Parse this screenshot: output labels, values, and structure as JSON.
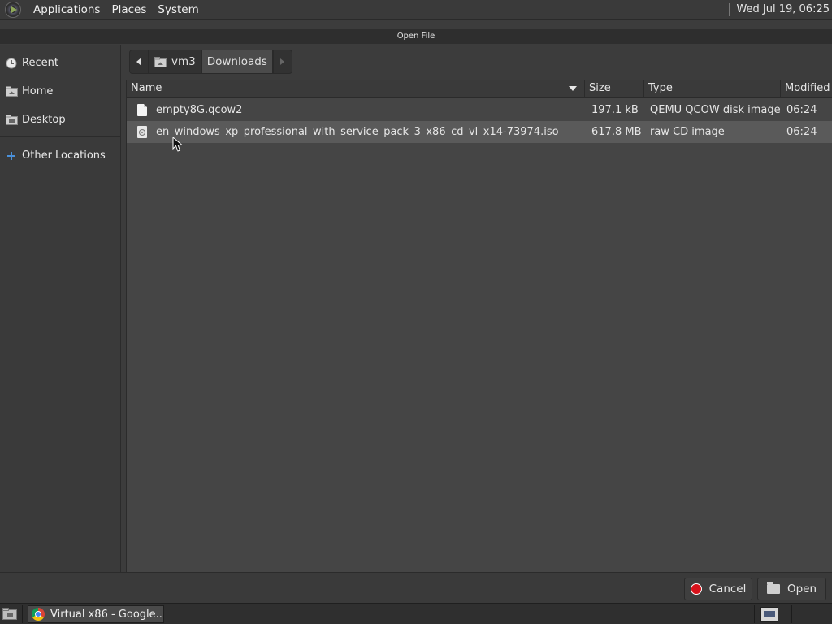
{
  "top_panel": {
    "menus": [
      "Applications",
      "Places",
      "System"
    ],
    "clock": "Wed Jul 19, 06:25"
  },
  "window": {
    "title": "Open File"
  },
  "sidebar": {
    "items": [
      {
        "label": "Recent",
        "icon": "recent-icon"
      },
      {
        "label": "Home",
        "icon": "home-icon"
      },
      {
        "label": "Desktop",
        "icon": "desktop-icon"
      },
      {
        "label": "Other Locations",
        "icon": "plus-icon"
      }
    ]
  },
  "pathbar": {
    "segments": [
      "vm3",
      "Downloads"
    ]
  },
  "filelist": {
    "columns": {
      "name": "Name",
      "size": "Size",
      "type": "Type",
      "modified": "Modified"
    },
    "rows": [
      {
        "name": "empty8G.qcow2",
        "size": "197.1 kB",
        "type": "QEMU QCOW disk image",
        "modified": "06:24",
        "icon": "file-icon",
        "selected": false
      },
      {
        "name": "en_windows_xp_professional_with_service_pack_3_x86_cd_vl_x14-73974.iso",
        "size": "617.8 MB",
        "type": "raw CD image",
        "modified": "06:24",
        "icon": "disc-image-icon",
        "selected": true
      }
    ]
  },
  "actions": {
    "cancel_label": "Cancel",
    "open_label": "Open"
  },
  "taskbar": {
    "task_label": "Virtual x86 - Google..."
  },
  "colors": {
    "selection": "#5a5a5a",
    "cancel": "#d8121b"
  }
}
